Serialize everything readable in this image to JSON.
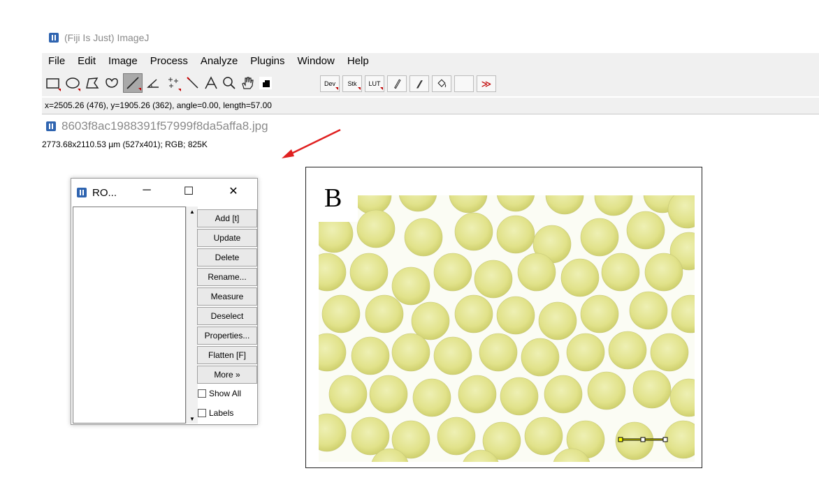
{
  "app": {
    "title": "(Fiji Is Just) ImageJ"
  },
  "menu": [
    "File",
    "Edit",
    "Image",
    "Process",
    "Analyze",
    "Plugins",
    "Window",
    "Help"
  ],
  "toolbar": {
    "tools": [
      "rectangle-tool-icon",
      "oval-tool-icon",
      "polygon-tool-icon",
      "freehand-tool-icon",
      "line-tool-icon",
      "angle-tool-icon",
      "point-tool-icon",
      "wand-tool-icon",
      "text-tool-icon",
      "zoom-tool-icon",
      "hand-tool-icon",
      "color-picker-icon"
    ],
    "selected": "line-tool-icon",
    "extras": {
      "dev": "Dev",
      "stk": "Stk",
      "lut": "LUT",
      "more": "≫"
    }
  },
  "status": "x=2505.26 (476), y=1905.26 (362), angle=0.00, length=57.00",
  "image_window": {
    "title": "8603f8ac1988391f57999f8da5affa8.jpg",
    "info": "2773.68x2110.53 µm (527x401); RGB; 825K",
    "panel_label": "B"
  },
  "roi_manager": {
    "title": "RO...",
    "buttons": [
      "Add [t]",
      "Update",
      "Delete",
      "Rename...",
      "Measure",
      "Deselect",
      "Properties...",
      "Flatten [F]",
      "More »"
    ],
    "checkboxes": [
      "Show All",
      "Labels"
    ]
  },
  "colors": {
    "menu_bg": "#f0f0f0",
    "arrow": "#e02020",
    "cell": "#e3e38f",
    "background": "#fbfcf4"
  }
}
